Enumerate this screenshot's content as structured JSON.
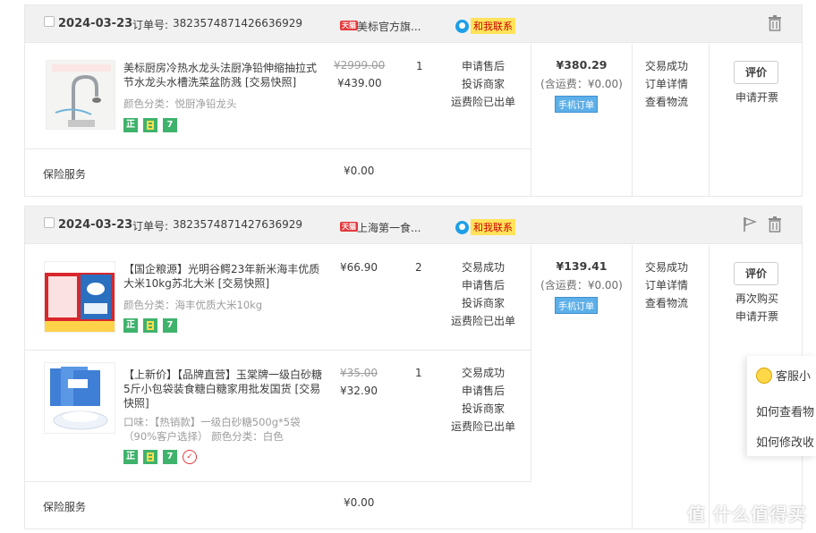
{
  "orders": [
    {
      "date": "2024-03-23",
      "order_no_label": "订单号:",
      "order_no": "3823574871426636929",
      "shop_badge": "天猫",
      "shop_name": "美标官方旗...",
      "contact_label": "和我联系",
      "items": [
        {
          "title": "美标厨房冷热水龙头法厨净铅伸缩抽拉式节水龙头水槽洗菜盆防溅 [交易快照]",
          "sku": "颜色分类：悦厨净铅龙头",
          "orig_price": "¥2999.00",
          "price": "¥439.00",
          "qty": "1",
          "ops": [
            "申请售后",
            "投诉商家",
            "运费险已出单"
          ]
        }
      ],
      "total": "¥380.29",
      "total_sub": "(含运费：¥0.00)",
      "mobile_tag": "手机订单",
      "status": [
        "交易成功",
        "订单详情",
        "查看物流"
      ],
      "eval_button": "评价",
      "after": [
        "申请开票"
      ],
      "insurance_label": "保险服务",
      "insurance_value": "¥0.00"
    },
    {
      "date": "2024-03-23",
      "order_no_label": "订单号:",
      "order_no": "3823574871427636929",
      "shop_badge": "天猫",
      "shop_name": "上海第一食...",
      "contact_label": "和我联系",
      "items": [
        {
          "title": "【国企粮源】光明谷鳄23年新米海丰优质大米10kg苏北大米 [交易快照]",
          "sku": "颜色分类：海丰优质大米10kg",
          "price": "¥66.90",
          "qty": "2",
          "ops": [
            "交易成功",
            "申请售后",
            "投诉商家",
            "运费险已出单"
          ]
        },
        {
          "title": "【上新价】【品牌直营】玉棠牌一级白砂糖5斤小包袋装食糖白糖家用批发国货 [交易快照]",
          "sku_line1": "口味：【热销款】一级白砂糖500g*5袋",
          "sku_line2": "（90%客户选择）  颜色分类：白色",
          "orig_price": "¥35.00",
          "price": "¥32.90",
          "qty": "1",
          "ops": [
            "交易成功",
            "申请售后",
            "投诉商家",
            "运费险已出单"
          ]
        }
      ],
      "total": "¥139.41",
      "total_sub": "(含运费：¥0.00)",
      "mobile_tag": "手机订单",
      "status": [
        "交易成功",
        "订单详情",
        "查看物流"
      ],
      "eval_button": "评价",
      "after": [
        "再次购买",
        "申请开票"
      ],
      "insurance_label": "保险服务",
      "insurance_value": "¥0.00"
    }
  ],
  "badges": {
    "zheng": "正",
    "seven": "7"
  },
  "cs_panel": {
    "title": "客服小",
    "q1": "如何查看物",
    "q2": "如何修改收"
  },
  "watermark": "值 什么值得买",
  "colors": {
    "tmall": "#e4393c",
    "contact_label_bg": "#ffe35a",
    "badge_green": "#3fb26c",
    "mobile_tag": "#5dafe8"
  }
}
